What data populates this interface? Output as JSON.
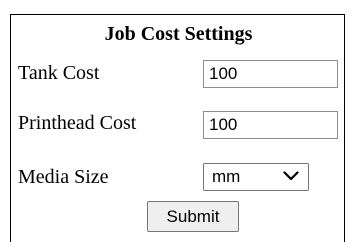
{
  "form": {
    "title": "Job Cost Settings",
    "fields": [
      {
        "label": "Tank Cost",
        "value": "100"
      },
      {
        "label": "Printhead Cost",
        "value": "100"
      }
    ],
    "media_size": {
      "label": "Media Size",
      "selected": "mm",
      "icon": "chevron-down-icon"
    },
    "submit_label": "Submit"
  },
  "colors": {
    "border": "#000000",
    "input_border": "#8d8d8d",
    "button_bg": "#efefef"
  }
}
